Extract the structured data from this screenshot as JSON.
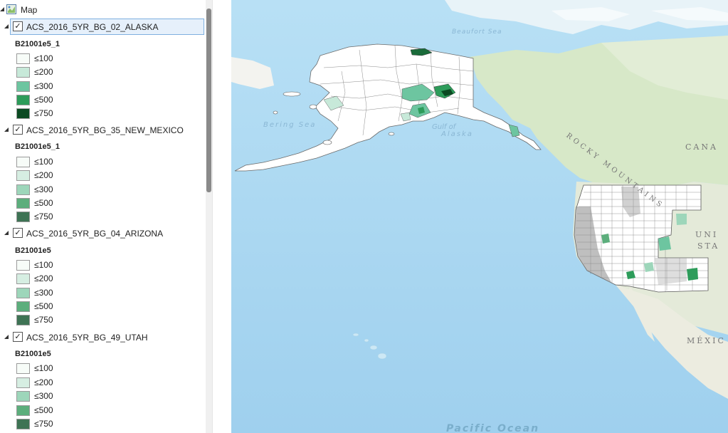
{
  "toc": {
    "map_label": "Map",
    "layers": [
      {
        "name": "ACS_2016_5YR_BG_02_ALASKA",
        "field": "B21001e5_1",
        "selected": true,
        "classes": [
          {
            "label": "≤100",
            "color": "#f7fcf8"
          },
          {
            "label": "≤200",
            "color": "#c7e9d9"
          },
          {
            "label": "≤300",
            "color": "#6dc5a0"
          },
          {
            "label": "≤500",
            "color": "#2d9c5a"
          },
          {
            "label": "≤750",
            "color": "#0b4a22"
          }
        ]
      },
      {
        "name": "ACS_2016_5YR_BG_35_NEW_MEXICO",
        "field": "B21001e5_1",
        "selected": false,
        "classes": [
          {
            "label": "≤100",
            "color": "#f7fcf8"
          },
          {
            "label": "≤200",
            "color": "#d6eee2"
          },
          {
            "label": "≤300",
            "color": "#9dd6ba"
          },
          {
            "label": "≤500",
            "color": "#5cae7c"
          },
          {
            "label": "≤750",
            "color": "#3e7354"
          }
        ]
      },
      {
        "name": "ACS_2016_5YR_BG_04_ARIZONA",
        "field": "B21001e5",
        "selected": false,
        "classes": [
          {
            "label": "≤100",
            "color": "#f7fcf8"
          },
          {
            "label": "≤200",
            "color": "#d6eee2"
          },
          {
            "label": "≤300",
            "color": "#9dd6ba"
          },
          {
            "label": "≤500",
            "color": "#5cae7c"
          },
          {
            "label": "≤750",
            "color": "#3e7354"
          }
        ]
      },
      {
        "name": "ACS_2016_5YR_BG_49_UTAH",
        "field": "B21001e5",
        "selected": false,
        "classes": [
          {
            "label": "≤100",
            "color": "#f7fcf8"
          },
          {
            "label": "≤200",
            "color": "#d6eee2"
          },
          {
            "label": "≤300",
            "color": "#9dd6ba"
          },
          {
            "label": "≤500",
            "color": "#5cae7c"
          },
          {
            "label": "≤750",
            "color": "#3e7354"
          }
        ]
      }
    ]
  },
  "map": {
    "labels": {
      "beaufort": "Beaufort Sea",
      "bering": "Bering Sea",
      "gulf_alaska_1": "Gulf of",
      "gulf_alaska_2": "Alaska",
      "rocky": "ROCKY MOUNTAINS",
      "canada": "CANA",
      "united": "UNI",
      "states": "STA",
      "mexico": "MÉXIC",
      "pacific": "Pacific Ocean"
    }
  }
}
